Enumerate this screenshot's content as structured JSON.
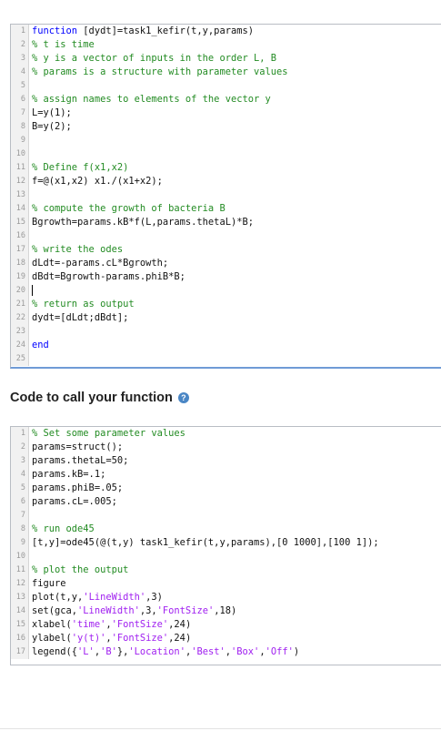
{
  "function_editor": {
    "lines": [
      {
        "n": "1",
        "parts": [
          {
            "t": "k",
            "v": "function"
          },
          {
            "t": "p",
            "v": " [dydt]=task1_kefir(t,y,params)"
          }
        ]
      },
      {
        "n": "2",
        "parts": [
          {
            "t": "c",
            "v": "% t is time"
          }
        ]
      },
      {
        "n": "3",
        "parts": [
          {
            "t": "c",
            "v": "% y is a vector of inputs in the order L, B"
          }
        ]
      },
      {
        "n": "4",
        "parts": [
          {
            "t": "c",
            "v": "% params is a structure with parameter values"
          }
        ]
      },
      {
        "n": "5",
        "parts": []
      },
      {
        "n": "6",
        "parts": [
          {
            "t": "c",
            "v": "% assign names to elements of the vector y"
          }
        ]
      },
      {
        "n": "7",
        "parts": [
          {
            "t": "p",
            "v": "L=y(1);"
          }
        ]
      },
      {
        "n": "8",
        "parts": [
          {
            "t": "p",
            "v": "B=y(2);"
          }
        ]
      },
      {
        "n": "9",
        "parts": []
      },
      {
        "n": "10",
        "parts": []
      },
      {
        "n": "11",
        "parts": [
          {
            "t": "c",
            "v": "% Define f(x1,x2)"
          }
        ]
      },
      {
        "n": "12",
        "parts": [
          {
            "t": "p",
            "v": "f=@(x1,x2) x1./(x1+x2);"
          }
        ]
      },
      {
        "n": "13",
        "parts": []
      },
      {
        "n": "14",
        "parts": [
          {
            "t": "c",
            "v": "% compute the growth of bacteria B"
          }
        ]
      },
      {
        "n": "15",
        "parts": [
          {
            "t": "p",
            "v": "Bgrowth=params.kB*f(L,params.thetaL)*B;"
          }
        ]
      },
      {
        "n": "16",
        "parts": []
      },
      {
        "n": "17",
        "parts": [
          {
            "t": "c",
            "v": "% write the odes"
          }
        ]
      },
      {
        "n": "18",
        "parts": [
          {
            "t": "p",
            "v": "dLdt=-params.cL*Bgrowth;"
          }
        ]
      },
      {
        "n": "19",
        "parts": [
          {
            "t": "p",
            "v": "dBdt=Bgrowth-params.phiB*B;"
          }
        ]
      },
      {
        "n": "20",
        "parts": [],
        "cursor": true
      },
      {
        "n": "21",
        "parts": [
          {
            "t": "c",
            "v": "% return as output"
          }
        ]
      },
      {
        "n": "22",
        "parts": [
          {
            "t": "p",
            "v": "dydt=[dLdt;dBdt];"
          }
        ]
      },
      {
        "n": "23",
        "parts": []
      },
      {
        "n": "24",
        "parts": [
          {
            "t": "k",
            "v": "end"
          }
        ]
      },
      {
        "n": "25",
        "parts": []
      }
    ]
  },
  "section_heading": {
    "text": "Code to call your function",
    "help_icon": "?"
  },
  "call_editor": {
    "lines": [
      {
        "n": "1",
        "parts": [
          {
            "t": "c",
            "v": "% Set some parameter values"
          }
        ]
      },
      {
        "n": "2",
        "parts": [
          {
            "t": "p",
            "v": "params=struct();"
          }
        ]
      },
      {
        "n": "3",
        "parts": [
          {
            "t": "p",
            "v": "params.thetaL=50;"
          }
        ]
      },
      {
        "n": "4",
        "parts": [
          {
            "t": "p",
            "v": "params.kB=.1;"
          }
        ]
      },
      {
        "n": "5",
        "parts": [
          {
            "t": "p",
            "v": "params.phiB=.05;"
          }
        ]
      },
      {
        "n": "6",
        "parts": [
          {
            "t": "p",
            "v": "params.cL=.005;"
          }
        ]
      },
      {
        "n": "7",
        "parts": []
      },
      {
        "n": "8",
        "parts": [
          {
            "t": "c",
            "v": "% run ode45"
          }
        ]
      },
      {
        "n": "9",
        "parts": [
          {
            "t": "p",
            "v": "[t,y]=ode45(@(t,y) task1_kefir(t,y,params),[0 1000],[100 1]);"
          }
        ]
      },
      {
        "n": "10",
        "parts": []
      },
      {
        "n": "11",
        "parts": [
          {
            "t": "c",
            "v": "% plot the output"
          }
        ]
      },
      {
        "n": "12",
        "parts": [
          {
            "t": "p",
            "v": "figure"
          }
        ]
      },
      {
        "n": "13",
        "parts": [
          {
            "t": "p",
            "v": "plot(t,y,"
          },
          {
            "t": "s",
            "v": "'LineWidth'"
          },
          {
            "t": "p",
            "v": ",3)"
          }
        ]
      },
      {
        "n": "14",
        "parts": [
          {
            "t": "p",
            "v": "set(gca,"
          },
          {
            "t": "s",
            "v": "'LineWidth'"
          },
          {
            "t": "p",
            "v": ",3,"
          },
          {
            "t": "s",
            "v": "'FontSize'"
          },
          {
            "t": "p",
            "v": ",18)"
          }
        ]
      },
      {
        "n": "15",
        "parts": [
          {
            "t": "p",
            "v": "xlabel("
          },
          {
            "t": "s",
            "v": "'time'"
          },
          {
            "t": "p",
            "v": ","
          },
          {
            "t": "s",
            "v": "'FontSize'"
          },
          {
            "t": "p",
            "v": ",24)"
          }
        ]
      },
      {
        "n": "16",
        "parts": [
          {
            "t": "p",
            "v": "ylabel("
          },
          {
            "t": "s",
            "v": "'y(t)'"
          },
          {
            "t": "p",
            "v": ","
          },
          {
            "t": "s",
            "v": "'FontSize'"
          },
          {
            "t": "p",
            "v": ",24)"
          }
        ]
      },
      {
        "n": "17",
        "parts": [
          {
            "t": "p",
            "v": "legend({"
          },
          {
            "t": "s",
            "v": "'L'"
          },
          {
            "t": "p",
            "v": ","
          },
          {
            "t": "s",
            "v": "'B'"
          },
          {
            "t": "p",
            "v": "},"
          },
          {
            "t": "s",
            "v": "'Location'"
          },
          {
            "t": "p",
            "v": ","
          },
          {
            "t": "s",
            "v": "'Best'"
          },
          {
            "t": "p",
            "v": ","
          },
          {
            "t": "s",
            "v": "'Box'"
          },
          {
            "t": "p",
            "v": ","
          },
          {
            "t": "s",
            "v": "'Off'"
          },
          {
            "t": "p",
            "v": ")"
          }
        ]
      }
    ]
  },
  "colors": {
    "comment": "#228b22",
    "keyword": "#0000ff",
    "string": "#a020f0",
    "focus_border": "#6f9bd6",
    "help_icon": "#4a86c5"
  }
}
